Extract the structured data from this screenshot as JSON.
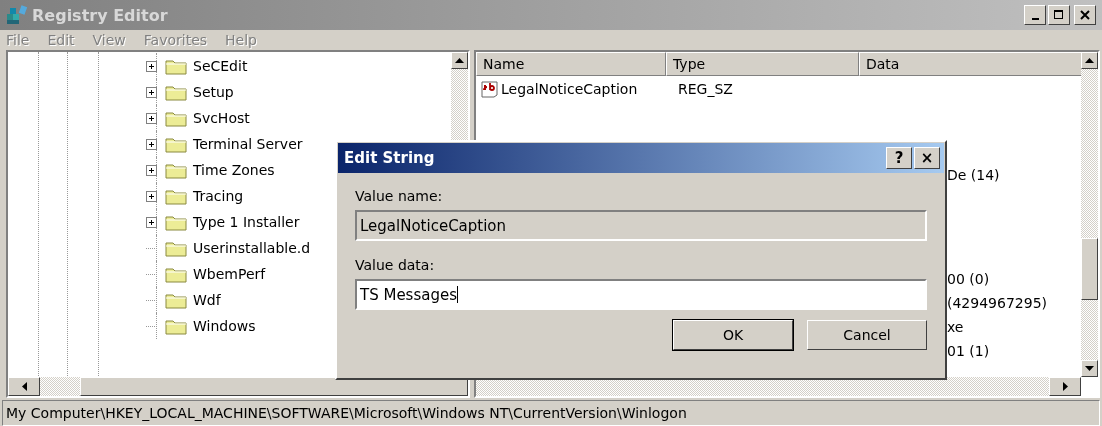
{
  "window": {
    "title": "Registry Editor"
  },
  "menu": [
    {
      "label": "File",
      "disabled": true
    },
    {
      "label": "Edit",
      "disabled": true
    },
    {
      "label": "View",
      "disabled": true
    },
    {
      "label": "Favorites",
      "disabled": true
    },
    {
      "label": "Help",
      "disabled": true
    }
  ],
  "tree": {
    "items": [
      {
        "label": "SeCEdit",
        "expandable": true
      },
      {
        "label": "Setup",
        "expandable": true
      },
      {
        "label": "SvcHost",
        "expandable": true
      },
      {
        "label": "Terminal Server",
        "expandable": true
      },
      {
        "label": "Time Zones",
        "expandable": true
      },
      {
        "label": "Tracing",
        "expandable": true
      },
      {
        "label": "Type 1 Installer",
        "expandable": true
      },
      {
        "label": "Userinstallable.d",
        "expandable": false
      },
      {
        "label": "WbemPerf",
        "expandable": false
      },
      {
        "label": "Wdf",
        "expandable": false
      },
      {
        "label": "Windows",
        "expandable": false
      }
    ]
  },
  "values": {
    "columns": [
      "Name",
      "Type",
      "Data"
    ],
    "rows": [
      {
        "kind": "full",
        "name": "LegalNoticeCaption",
        "type": "REG_SZ"
      },
      {
        "kind": "data_only",
        "data": "De (14)"
      },
      {
        "kind": "data_only",
        "data": "00 (0)"
      },
      {
        "kind": "data_only",
        "data": "(4294967295)"
      },
      {
        "kind": "data_only",
        "data": "xe"
      },
      {
        "kind": "data_only",
        "data": "01 (1)"
      }
    ]
  },
  "dialog": {
    "title": "Edit String",
    "help_button": "?",
    "close_button": "×",
    "name_label": "Value name:",
    "name_value": "LegalNoticeCaption",
    "data_label": "Value data:",
    "data_value": "TS Messages",
    "buttons": [
      {
        "label": "OK",
        "default": true
      },
      {
        "label": "Cancel",
        "default": false
      }
    ]
  },
  "status_bar": "My Computer\\HKEY_LOCAL_MACHINE\\SOFTWARE\\Microsoft\\Windows NT\\CurrentVersion\\Winlogon"
}
